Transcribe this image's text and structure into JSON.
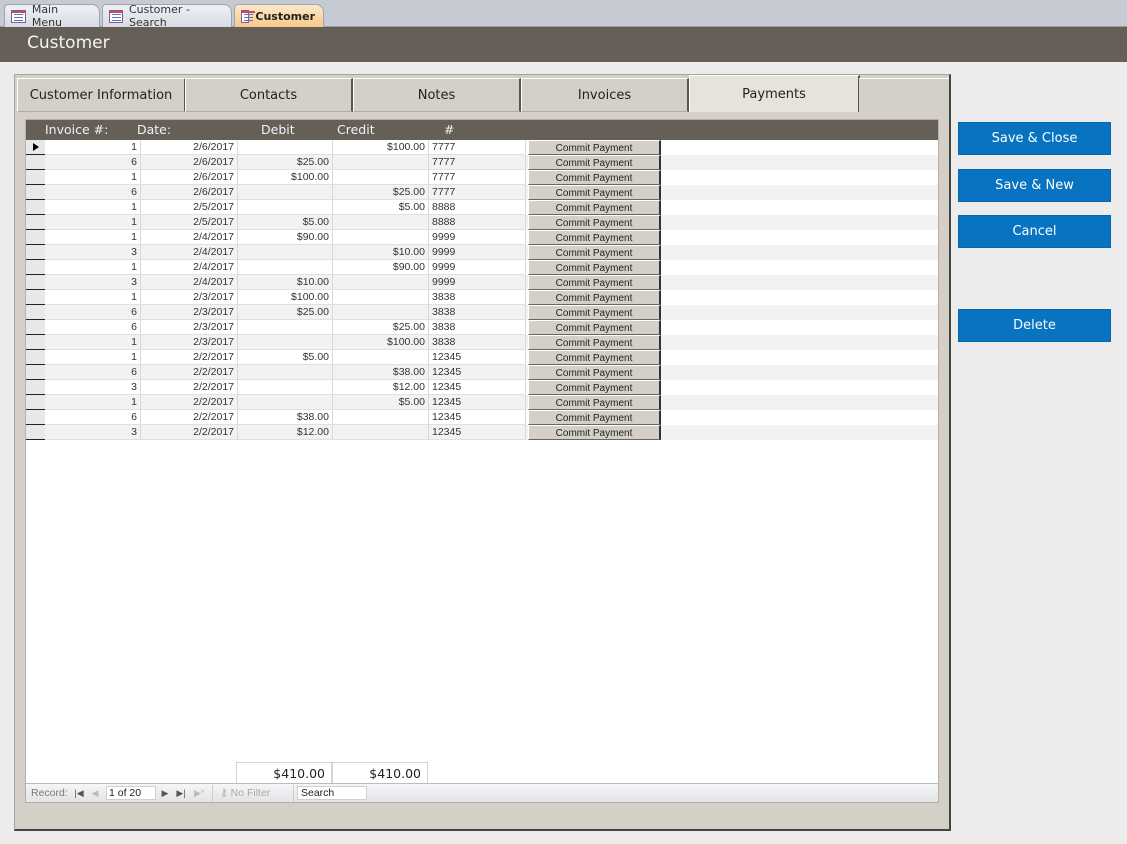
{
  "doc_tabs": [
    {
      "label": "Main Menu",
      "icon": "form-icon"
    },
    {
      "label": "Customer - Search",
      "icon": "form-icon"
    },
    {
      "label": "Customer",
      "icon": "form-icon",
      "active": true
    }
  ],
  "header": {
    "title": "Customer"
  },
  "page_tabs": [
    {
      "label": "Customer Information"
    },
    {
      "label": "Contacts"
    },
    {
      "label": "Notes"
    },
    {
      "label": "Invoices"
    },
    {
      "label": "Payments",
      "active": true
    }
  ],
  "grid": {
    "columns": [
      "Invoice #:",
      "Date:",
      "Debit",
      "Credit",
      "#"
    ],
    "commit_label": "Commit Payment",
    "rows": [
      {
        "invoice": "1",
        "date": "2/6/2017",
        "debit": "",
        "credit": "$100.00",
        "num": "7777"
      },
      {
        "invoice": "6",
        "date": "2/6/2017",
        "debit": "$25.00",
        "credit": "",
        "num": "7777"
      },
      {
        "invoice": "1",
        "date": "2/6/2017",
        "debit": "$100.00",
        "credit": "",
        "num": "7777"
      },
      {
        "invoice": "6",
        "date": "2/6/2017",
        "debit": "",
        "credit": "$25.00",
        "num": "7777"
      },
      {
        "invoice": "1",
        "date": "2/5/2017",
        "debit": "",
        "credit": "$5.00",
        "num": "8888"
      },
      {
        "invoice": "1",
        "date": "2/5/2017",
        "debit": "$5.00",
        "credit": "",
        "num": "8888"
      },
      {
        "invoice": "1",
        "date": "2/4/2017",
        "debit": "$90.00",
        "credit": "",
        "num": "9999"
      },
      {
        "invoice": "3",
        "date": "2/4/2017",
        "debit": "",
        "credit": "$10.00",
        "num": "9999"
      },
      {
        "invoice": "1",
        "date": "2/4/2017",
        "debit": "",
        "credit": "$90.00",
        "num": "9999"
      },
      {
        "invoice": "3",
        "date": "2/4/2017",
        "debit": "$10.00",
        "credit": "",
        "num": "9999"
      },
      {
        "invoice": "1",
        "date": "2/3/2017",
        "debit": "$100.00",
        "credit": "",
        "num": "3838"
      },
      {
        "invoice": "6",
        "date": "2/3/2017",
        "debit": "$25.00",
        "credit": "",
        "num": "3838"
      },
      {
        "invoice": "6",
        "date": "2/3/2017",
        "debit": "",
        "credit": "$25.00",
        "num": "3838"
      },
      {
        "invoice": "1",
        "date": "2/3/2017",
        "debit": "",
        "credit": "$100.00",
        "num": "3838"
      },
      {
        "invoice": "1",
        "date": "2/2/2017",
        "debit": "$5.00",
        "credit": "",
        "num": "12345"
      },
      {
        "invoice": "6",
        "date": "2/2/2017",
        "debit": "",
        "credit": "$38.00",
        "num": "12345"
      },
      {
        "invoice": "3",
        "date": "2/2/2017",
        "debit": "",
        "credit": "$12.00",
        "num": "12345"
      },
      {
        "invoice": "1",
        "date": "2/2/2017",
        "debit": "",
        "credit": "$5.00",
        "num": "12345"
      },
      {
        "invoice": "6",
        "date": "2/2/2017",
        "debit": "$38.00",
        "credit": "",
        "num": "12345"
      },
      {
        "invoice": "3",
        "date": "2/2/2017",
        "debit": "$12.00",
        "credit": "",
        "num": "12345"
      }
    ],
    "totals": {
      "debit": "$410.00",
      "credit": "$410.00"
    }
  },
  "navbar": {
    "record_label": "Record:",
    "record_value": "1 of 20",
    "filter_label": "No Filter",
    "search_value": "Search"
  },
  "actions": {
    "save_close": "Save & Close",
    "save_new": "Save & New",
    "cancel": "Cancel",
    "delete": "Delete"
  },
  "colors": {
    "header_bg": "#655f58",
    "button_blue": "#0873c0",
    "active_doc_tab": "#f8c88a"
  }
}
